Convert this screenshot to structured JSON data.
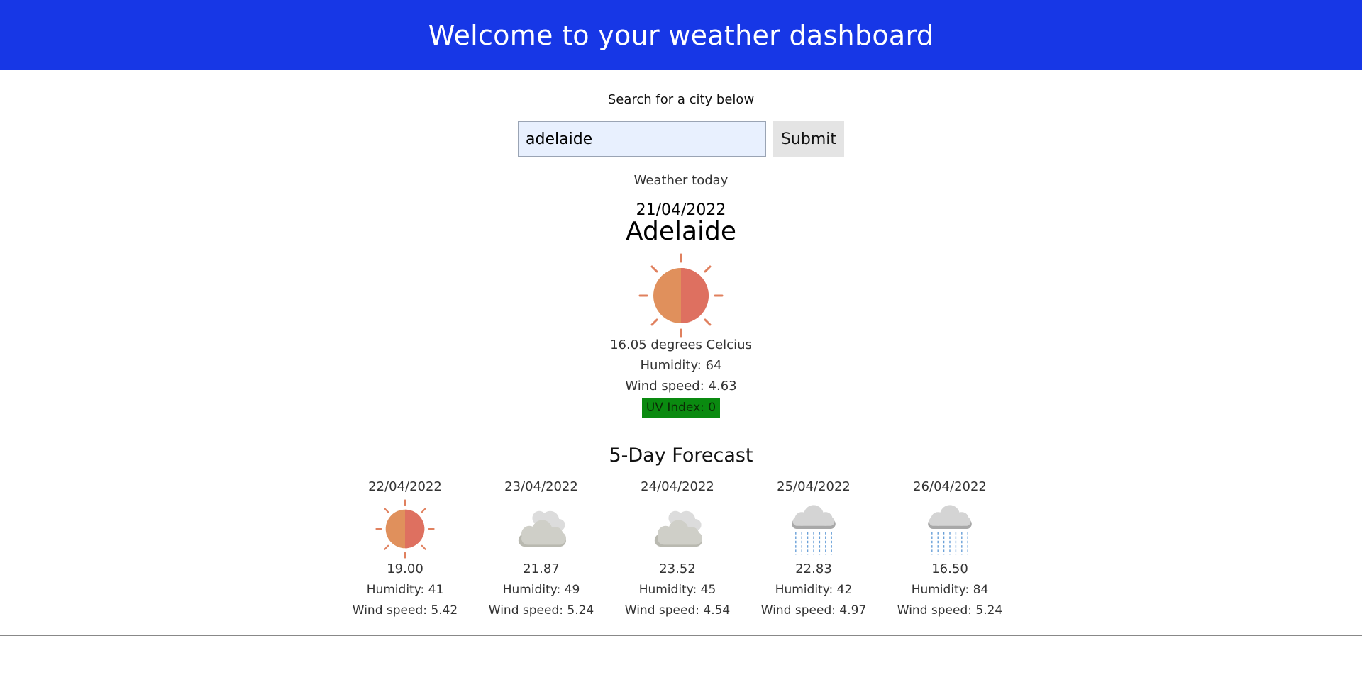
{
  "header": {
    "title": "Welcome to your weather dashboard"
  },
  "search": {
    "label": "Search for a city below",
    "value": "adelaide",
    "submit_label": "Submit"
  },
  "today": {
    "section_label": "Weather today",
    "date": "21/04/2022",
    "city": "Adelaide",
    "icon": "sun-icon",
    "temperature": "16.05 degrees Celcius",
    "humidity": "Humidity: 64",
    "wind": "Wind speed: 4.63",
    "uv": "UV Index: 0",
    "uv_color": "#0a8a10"
  },
  "forecast": {
    "title": "5-Day Forecast",
    "days": [
      {
        "date": "22/04/2022",
        "icon": "sun-icon",
        "temp": "19.00",
        "humidity": "Humidity: 41",
        "wind": "Wind speed: 5.42"
      },
      {
        "date": "23/04/2022",
        "icon": "clouds-icon",
        "temp": "21.87",
        "humidity": "Humidity: 49",
        "wind": "Wind speed: 5.24"
      },
      {
        "date": "24/04/2022",
        "icon": "clouds-icon",
        "temp": "23.52",
        "humidity": "Humidity: 45",
        "wind": "Wind speed: 4.54"
      },
      {
        "date": "25/04/2022",
        "icon": "rain-icon",
        "temp": "22.83",
        "humidity": "Humidity: 42",
        "wind": "Wind speed: 4.97"
      },
      {
        "date": "26/04/2022",
        "icon": "rain-icon",
        "temp": "16.50",
        "humidity": "Humidity: 84",
        "wind": "Wind speed: 5.24"
      }
    ]
  },
  "colors": {
    "header_bg": "#1737e6",
    "input_bg": "#e8f0fe"
  }
}
